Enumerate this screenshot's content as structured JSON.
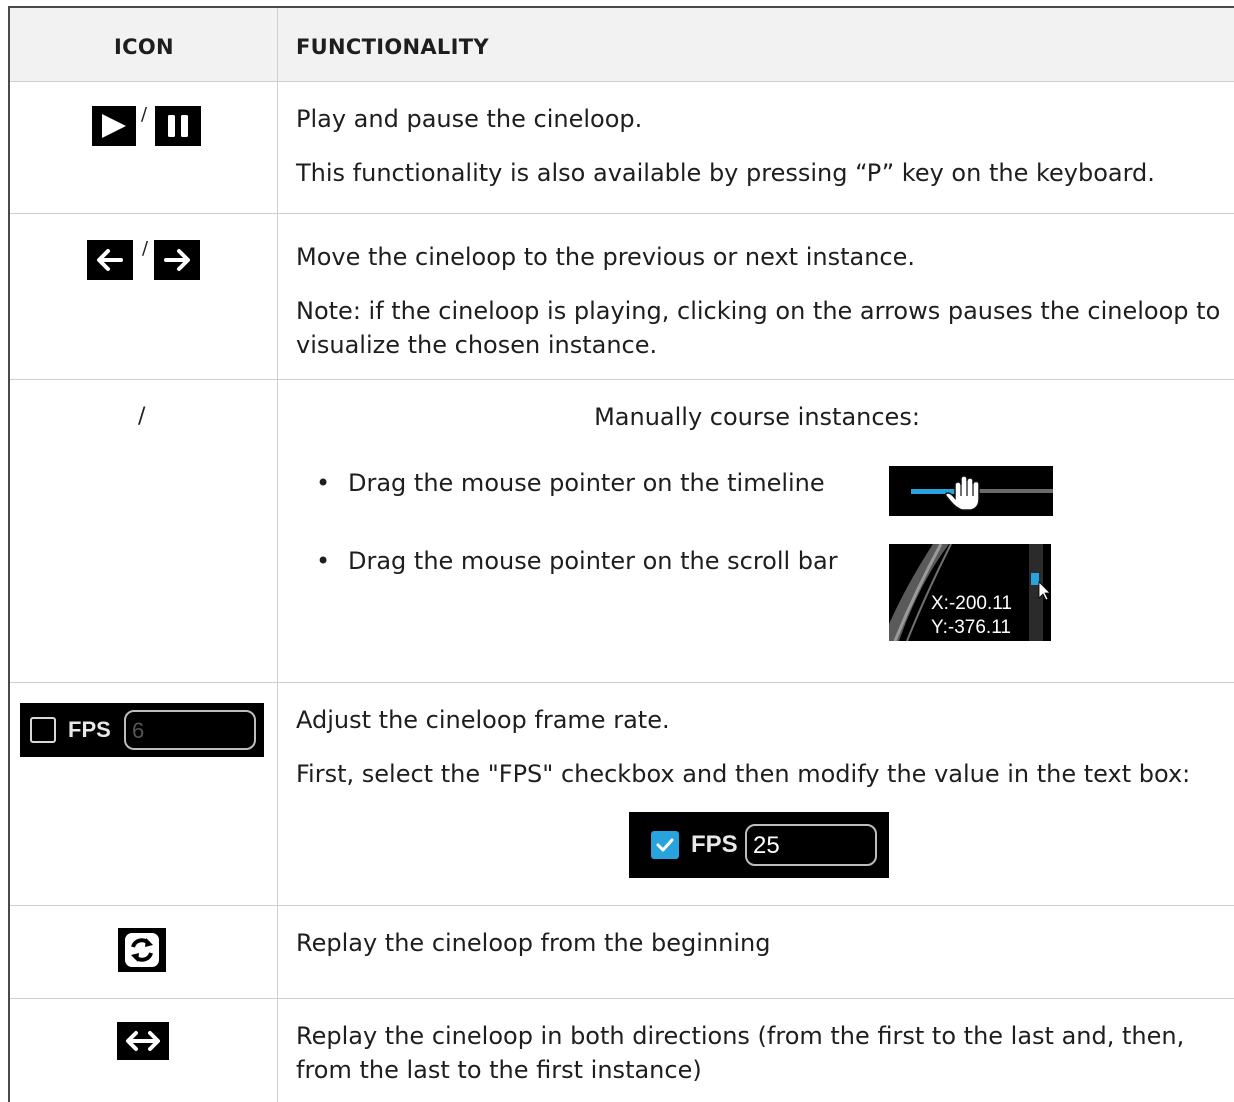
{
  "header": {
    "icon_col": "ICON",
    "func_col": "FUNCTIONALITY"
  },
  "rows": [
    {
      "separator": "/",
      "lines": [
        "Play and pause the cineloop.",
        "This functionality is also available by pressing “P” key on the keyboard."
      ],
      "icons": [
        "play-icon",
        "pause-icon"
      ]
    },
    {
      "separator": "/",
      "lines": [
        "Move the cineloop to the previous or next instance.",
        "Note: if the cineloop is playing, clicking on the arrows pauses the cineloop to visualize the chosen instance."
      ],
      "icons": [
        "arrow-left-icon",
        "arrow-right-icon"
      ]
    },
    {
      "separator": "/",
      "title": "Manually course instances:",
      "bullets": [
        "Drag the mouse pointer on the timeline",
        "Drag the mouse pointer on the scroll bar"
      ],
      "scroll_readout": {
        "x": "X:-200.11",
        "y": "Y:-376.11"
      }
    },
    {
      "lines": [
        "Adjust the cineloop frame rate.",
        "First, select the \"FPS\" checkbox and then modify the value in the text box:"
      ],
      "fps_unchecked": {
        "label": "FPS",
        "value": "6",
        "checked": false
      },
      "fps_checked": {
        "label": "FPS",
        "value": "25",
        "checked": true
      }
    },
    {
      "lines": [
        "Replay the cineloop from the beginning"
      ],
      "icons": [
        "replay-icon"
      ]
    },
    {
      "lines": [
        "Replay the cineloop in both directions (from the first to the last and, then, from the last to the first instance)"
      ],
      "icons": [
        "bidirectional-arrow-icon"
      ]
    }
  ],
  "colors": {
    "accent": "#29a3dd",
    "header_bg": "#f2f2f2",
    "icon_bg": "#000000"
  }
}
